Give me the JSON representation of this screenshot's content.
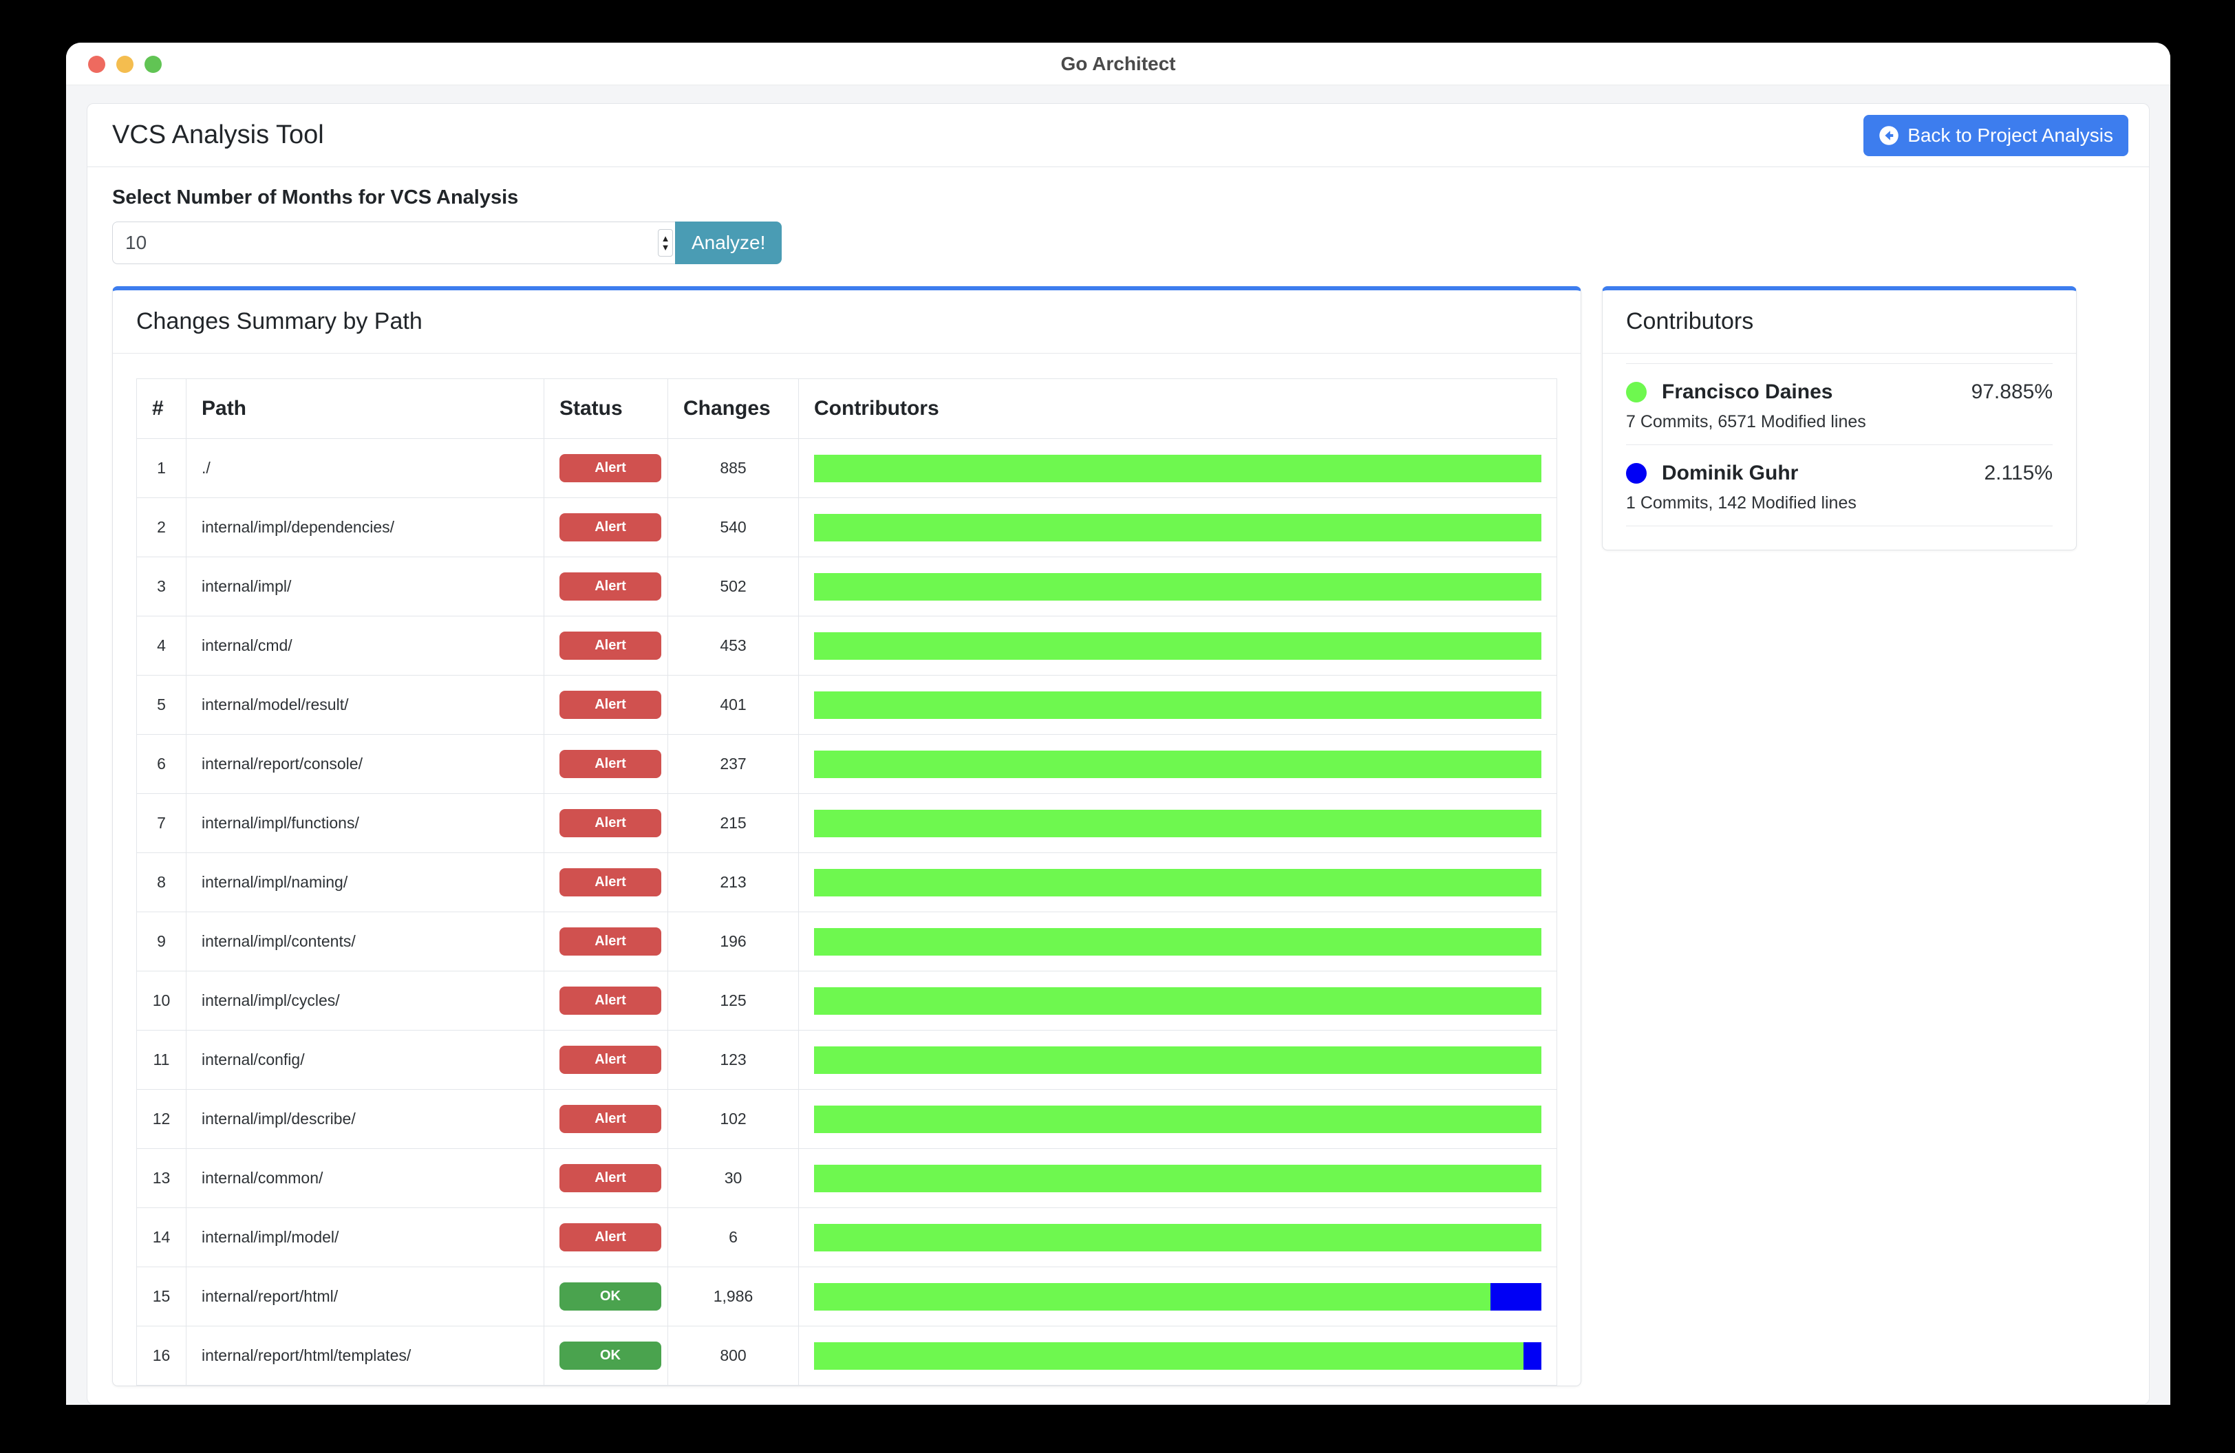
{
  "window": {
    "title": "Go Architect",
    "traffic_lights": [
      "close-red",
      "minimize-yellow",
      "maximize-green"
    ]
  },
  "header": {
    "app_title": "VCS Analysis Tool",
    "back_button": {
      "label": "Back to Project Analysis",
      "icon": "arrow-left-circle-icon",
      "color": "#3d7dee"
    }
  },
  "form": {
    "label": "Select Number of Months for VCS Analysis",
    "months_value": "10",
    "months_placeholder": "10",
    "analyze_label": "Analyze!",
    "analyze_color": "#4a9cb4"
  },
  "colors": {
    "panel_accent": "#3d7dee",
    "alert": "#d0514f",
    "ok": "#4aa34e",
    "contributor_green": "#6ef84f",
    "contributor_blue": "#0000f5",
    "page_background": "#f4f5f7"
  },
  "changes_panel": {
    "title": "Changes Summary by Path",
    "columns": [
      "#",
      "Path",
      "Status",
      "Changes",
      "Contributors"
    ],
    "rows": [
      {
        "num": "1",
        "path": "./",
        "status": "Alert",
        "status_kind": "alert",
        "changes": "885",
        "segments": [
          {
            "color": "#6ef84f",
            "pct": 100
          }
        ]
      },
      {
        "num": "2",
        "path": "internal/impl/dependencies/",
        "status": "Alert",
        "status_kind": "alert",
        "changes": "540",
        "segments": [
          {
            "color": "#6ef84f",
            "pct": 100
          }
        ]
      },
      {
        "num": "3",
        "path": "internal/impl/",
        "status": "Alert",
        "status_kind": "alert",
        "changes": "502",
        "segments": [
          {
            "color": "#6ef84f",
            "pct": 100
          }
        ]
      },
      {
        "num": "4",
        "path": "internal/cmd/",
        "status": "Alert",
        "status_kind": "alert",
        "changes": "453",
        "segments": [
          {
            "color": "#6ef84f",
            "pct": 100
          }
        ]
      },
      {
        "num": "5",
        "path": "internal/model/result/",
        "status": "Alert",
        "status_kind": "alert",
        "changes": "401",
        "segments": [
          {
            "color": "#6ef84f",
            "pct": 100
          }
        ]
      },
      {
        "num": "6",
        "path": "internal/report/console/",
        "status": "Alert",
        "status_kind": "alert",
        "changes": "237",
        "segments": [
          {
            "color": "#6ef84f",
            "pct": 100
          }
        ]
      },
      {
        "num": "7",
        "path": "internal/impl/functions/",
        "status": "Alert",
        "status_kind": "alert",
        "changes": "215",
        "segments": [
          {
            "color": "#6ef84f",
            "pct": 100
          }
        ]
      },
      {
        "num": "8",
        "path": "internal/impl/naming/",
        "status": "Alert",
        "status_kind": "alert",
        "changes": "213",
        "segments": [
          {
            "color": "#6ef84f",
            "pct": 100
          }
        ]
      },
      {
        "num": "9",
        "path": "internal/impl/contents/",
        "status": "Alert",
        "status_kind": "alert",
        "changes": "196",
        "segments": [
          {
            "color": "#6ef84f",
            "pct": 100
          }
        ]
      },
      {
        "num": "10",
        "path": "internal/impl/cycles/",
        "status": "Alert",
        "status_kind": "alert",
        "changes": "125",
        "segments": [
          {
            "color": "#6ef84f",
            "pct": 100
          }
        ]
      },
      {
        "num": "11",
        "path": "internal/config/",
        "status": "Alert",
        "status_kind": "alert",
        "changes": "123",
        "segments": [
          {
            "color": "#6ef84f",
            "pct": 100
          }
        ]
      },
      {
        "num": "12",
        "path": "internal/impl/describe/",
        "status": "Alert",
        "status_kind": "alert",
        "changes": "102",
        "segments": [
          {
            "color": "#6ef84f",
            "pct": 100
          }
        ]
      },
      {
        "num": "13",
        "path": "internal/common/",
        "status": "Alert",
        "status_kind": "alert",
        "changes": "30",
        "segments": [
          {
            "color": "#6ef84f",
            "pct": 100
          }
        ]
      },
      {
        "num": "14",
        "path": "internal/impl/model/",
        "status": "Alert",
        "status_kind": "alert",
        "changes": "6",
        "segments": [
          {
            "color": "#6ef84f",
            "pct": 100
          }
        ]
      },
      {
        "num": "15",
        "path": "internal/report/html/",
        "status": "OK",
        "status_kind": "ok",
        "changes": "1,986",
        "segments": [
          {
            "color": "#6ef84f",
            "pct": 93
          },
          {
            "color": "#0000f5",
            "pct": 7
          }
        ]
      },
      {
        "num": "16",
        "path": "internal/report/html/templates/",
        "status": "OK",
        "status_kind": "ok",
        "changes": "800",
        "segments": [
          {
            "color": "#6ef84f",
            "pct": 97.5
          },
          {
            "color": "#0000f5",
            "pct": 2.5
          }
        ]
      }
    ]
  },
  "contributors_panel": {
    "title": "Contributors",
    "items": [
      {
        "dot_color": "#6ef84f",
        "name": "Francisco Daines",
        "percent": "97.885%",
        "meta": "7 Commits, 6571 Modified lines"
      },
      {
        "dot_color": "#0000f5",
        "name": "Dominik Guhr",
        "percent": "2.115%",
        "meta": "1 Commits, 142 Modified lines"
      }
    ]
  }
}
